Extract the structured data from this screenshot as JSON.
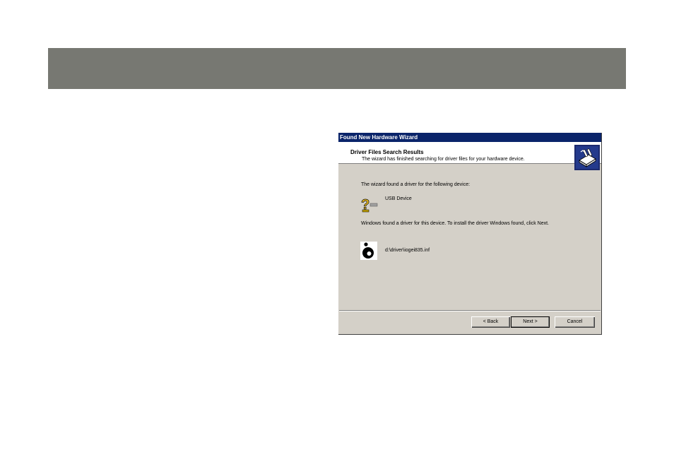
{
  "colors": {
    "band": "#777872",
    "dialog_face": "#d4d0c8",
    "titlebar": "#0a246a"
  },
  "dialog": {
    "title": "Found New Hardware Wizard",
    "header_title": "Driver Files Search Results",
    "header_subtitle": "The wizard has finished searching for driver files for your hardware device.",
    "header_icon": "hardware-wizard-icon",
    "found_text": "The wizard found a driver for the following device:",
    "device_name": "USB Device",
    "device_icon": "unknown-device-icon",
    "install_text": "Windows found a driver for this device. To install the driver Windows found, click Next.",
    "driver_path": "d:\\driver\\iogei835.inf",
    "driver_icon": "inf-file-icon"
  },
  "buttons": {
    "back": "< Back",
    "next": "Next >",
    "cancel": "Cancel"
  }
}
